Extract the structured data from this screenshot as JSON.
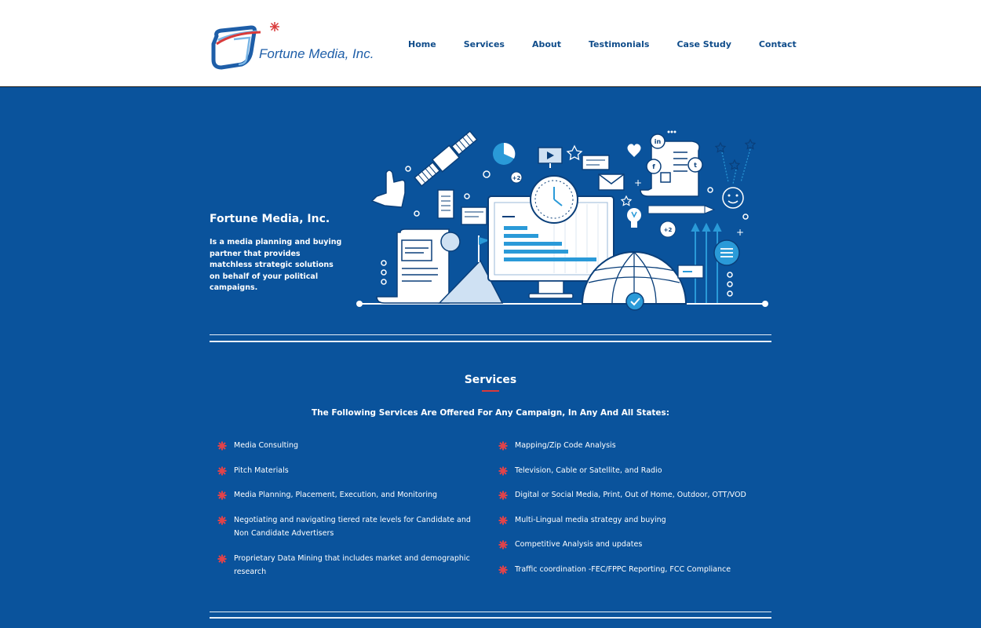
{
  "brand": {
    "name": "Fortune Media, Inc.",
    "colors": {
      "primary_blue": "#0a539c",
      "nav_blue": "#0f4c8a",
      "accent_red": "#d93a3a",
      "light_blue": "#7ec8f0"
    }
  },
  "nav": {
    "items": [
      {
        "label": "Home"
      },
      {
        "label": "Services"
      },
      {
        "label": "About"
      },
      {
        "label": "Testimonials"
      },
      {
        "label": "Case Study"
      },
      {
        "label": "Contact"
      }
    ]
  },
  "hero": {
    "title": "Fortune Media, Inc.",
    "description": "Is a media planning and buying partner that provides matchless strategic solutions on behalf of your political campaigns.",
    "illustration_labels": {
      "plus_two": "+2",
      "in": "in",
      "f": "f",
      "t": "t"
    }
  },
  "services": {
    "heading": "Services",
    "subheading": "The Following Services Are Offered For Any Campaign, In Any And All States:",
    "left": [
      "Media Consulting",
      "Pitch Materials",
      "Media Planning, Placement, Execution, and Monitoring",
      "Negotiating and navigating tiered rate levels for Candidate and Non Candidate Advertisers",
      "Proprietary Data Mining that includes market and demographic research"
    ],
    "right": [
      "Mapping/Zip Code Analysis",
      "Television, Cable or Satellite, and Radio",
      "Digital or Social Media, Print, Out of Home, Outdoor, OTT/VOD",
      "Multi-Lingual media strategy and buying",
      "Competitive Analysis and updates",
      "Traffic coordination -FEC/FPPC Reporting, FCC Compliance"
    ],
    "bullet_icon": "red-asterisk-icon"
  }
}
